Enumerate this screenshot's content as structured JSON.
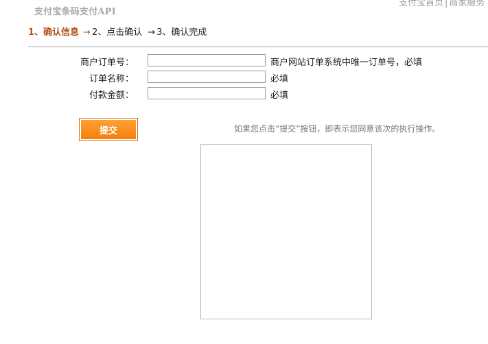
{
  "header": {
    "top_links": {
      "home": "支付宝首页",
      "separator": "|",
      "merchant": "商家服务"
    },
    "app_title": "支付宝条码支付API"
  },
  "steps": {
    "step1": "1、确认信息",
    "step2": "2、点击确认",
    "step3": "3、确认完成",
    "arrow": "→"
  },
  "form": {
    "order_no": {
      "label": "商户订单号：",
      "value": "",
      "hint": "商户网站订单系统中唯一订单号，必填"
    },
    "order_name": {
      "label": "订单名称：",
      "value": "",
      "hint": "必填"
    },
    "amount": {
      "label": "付款金额：",
      "value": "",
      "hint": "必填"
    },
    "submit_label": "提交",
    "notice": "如果您点击“提交”按钮，即表示您同意该次的执行操作。"
  },
  "colors": {
    "accent": "#f47f0a",
    "step_current": "#b0501a"
  }
}
